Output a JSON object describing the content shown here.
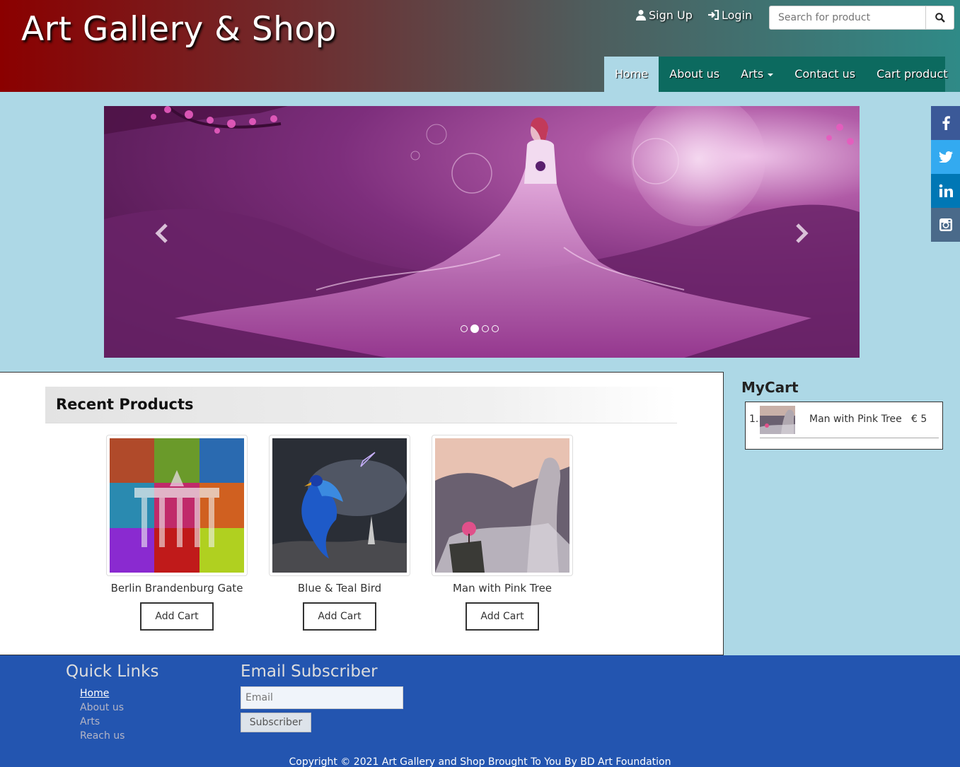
{
  "header": {
    "title": "Art Gallery & Shop",
    "signup_label": "Sign Up",
    "login_label": "Login",
    "search_placeholder": "Search for product"
  },
  "nav": {
    "items": [
      {
        "label": "Home",
        "active": true
      },
      {
        "label": "About us"
      },
      {
        "label": "Arts",
        "dropdown": true
      },
      {
        "label": "Contact us"
      },
      {
        "label": "Cart product"
      }
    ]
  },
  "social": [
    {
      "icon": "facebook-icon",
      "color": "#3b5998"
    },
    {
      "icon": "twitter-icon",
      "color": "#33aaf0"
    },
    {
      "icon": "linkedin-icon",
      "color": "#0077b5"
    },
    {
      "icon": "instagram-icon",
      "color": "#4a6a8a"
    }
  ],
  "carousel": {
    "slide_count": 4,
    "active_index": 1
  },
  "recent": {
    "heading": "Recent Products",
    "products": [
      {
        "name": "Berlin Brandenburg Gate",
        "button": "Add Cart"
      },
      {
        "name": "Blue & Teal Bird",
        "button": "Add Cart"
      },
      {
        "name": "Man with Pink Tree",
        "button": "Add Cart"
      }
    ]
  },
  "cart": {
    "title": "MyCart",
    "items": [
      {
        "index": "1.",
        "name": "Man with Pink Tree",
        "price": "€ 5"
      }
    ]
  },
  "footer": {
    "quick_links_heading": "Quick Links",
    "links": [
      "Home",
      "About us",
      "Arts",
      "Reach us"
    ],
    "email_heading": "Email Subscriber",
    "email_placeholder": "Email",
    "subscribe_label": "Subscriber",
    "copyright": "Copyright © 2021 Art Gallery and Shop Brought To You By BD Art Foundation"
  },
  "colors": {
    "page_bg": "#add8e6",
    "nav_bg": "#0c6a5f",
    "footer_bg": "#2355b0"
  }
}
